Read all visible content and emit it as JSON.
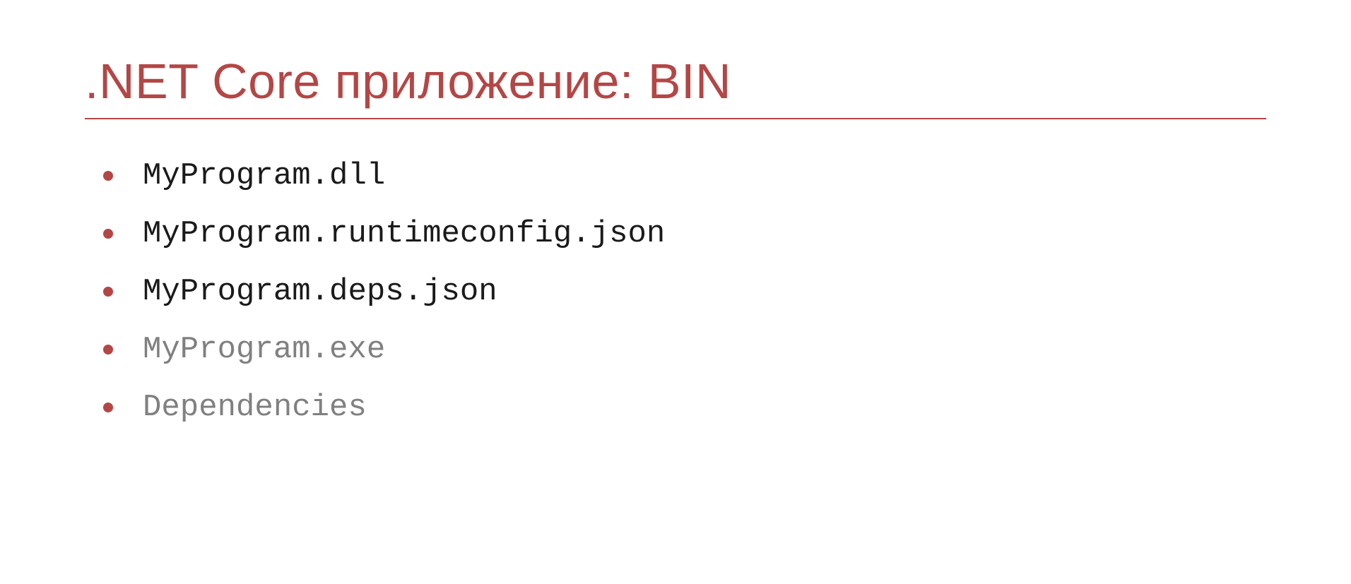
{
  "title": ".NET Core приложение: BIN",
  "items": [
    {
      "text": "MyProgram.dll",
      "style": "dark"
    },
    {
      "text": "MyProgram.runtimeconfig.json",
      "style": "dark"
    },
    {
      "text": "MyProgram.deps.json",
      "style": "dark"
    },
    {
      "text": "MyProgram.exe",
      "style": "muted"
    },
    {
      "text": "Dependencies",
      "style": "muted"
    }
  ]
}
